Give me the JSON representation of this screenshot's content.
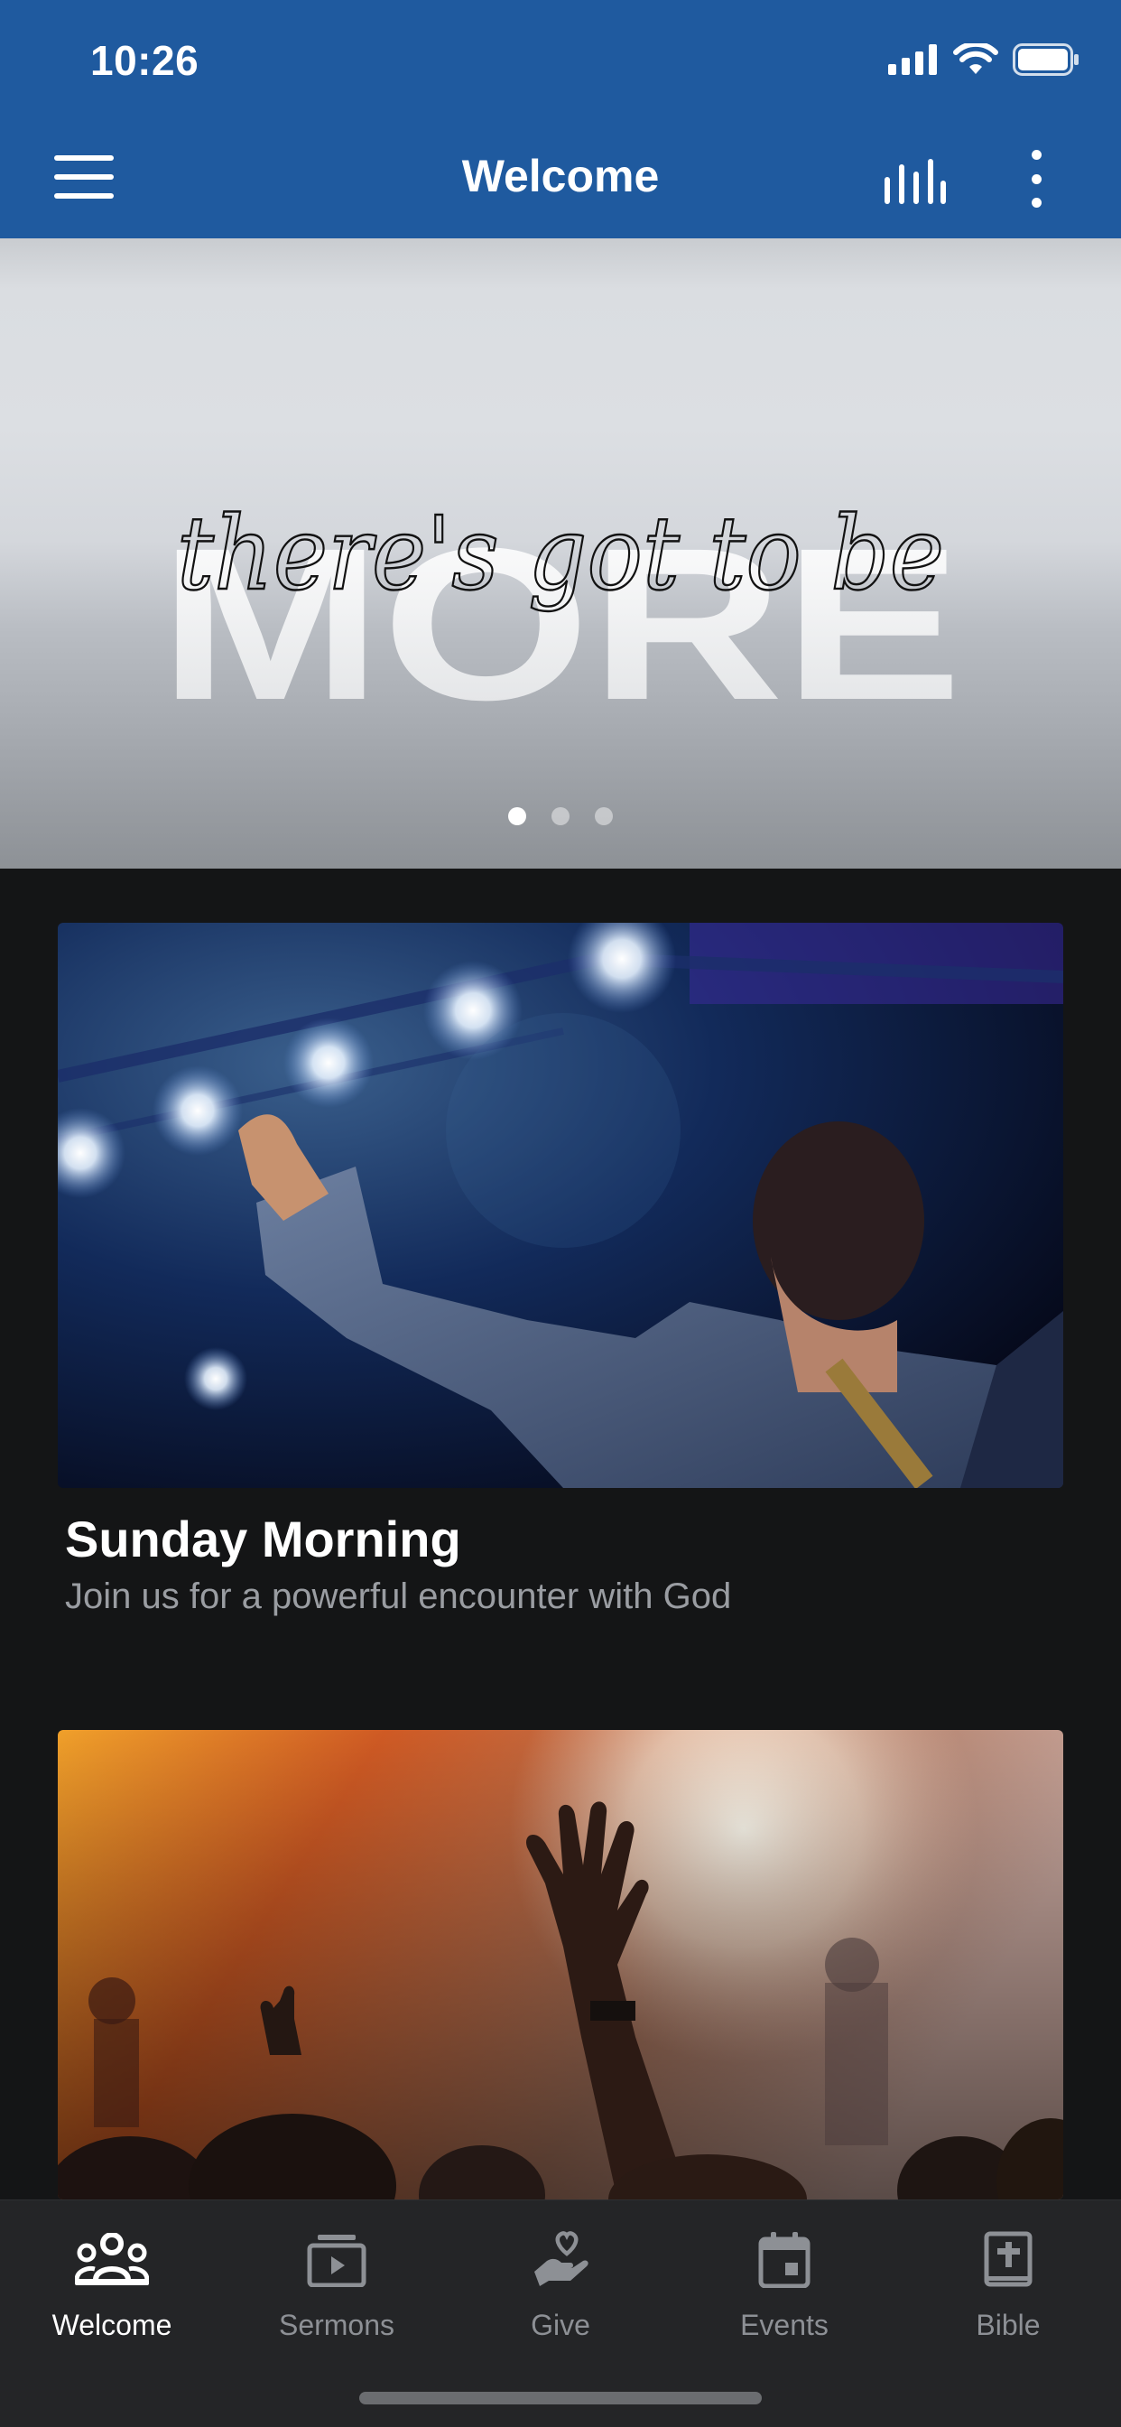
{
  "status_bar": {
    "time": "10:26",
    "icons": [
      "signal-icon",
      "wifi-icon",
      "battery-icon"
    ]
  },
  "header": {
    "title": "Welcome",
    "background": "#1f5a9f",
    "left_icon": "hamburger-menu-icon",
    "right_icons": [
      "audio-bars-icon",
      "more-vertical-icon"
    ]
  },
  "hero": {
    "script_text": "there's got to be",
    "big_text": "MORE",
    "slides": {
      "count": 3,
      "active": 1
    }
  },
  "cards": [
    {
      "title": "Sunday Morning",
      "subtitle": "Join us for a powerful encounter with God",
      "image": "concert-crowd-photo"
    },
    {
      "image": "worship-hands-photo"
    }
  ],
  "tabs": [
    {
      "label": "Welcome",
      "icon": "people-group-icon",
      "active": true
    },
    {
      "label": "Sermons",
      "icon": "video-library-icon",
      "active": false
    },
    {
      "label": "Give",
      "icon": "hand-heart-icon",
      "active": false
    },
    {
      "label": "Events",
      "icon": "calendar-icon",
      "active": false
    },
    {
      "label": "Bible",
      "icon": "bible-book-icon",
      "active": false
    }
  ],
  "colors": {
    "accent": "#1f5a9f",
    "background": "#141516",
    "tabbar": "#242527",
    "tab_inactive": "#8d9095",
    "subtitle": "#9a9da2"
  }
}
